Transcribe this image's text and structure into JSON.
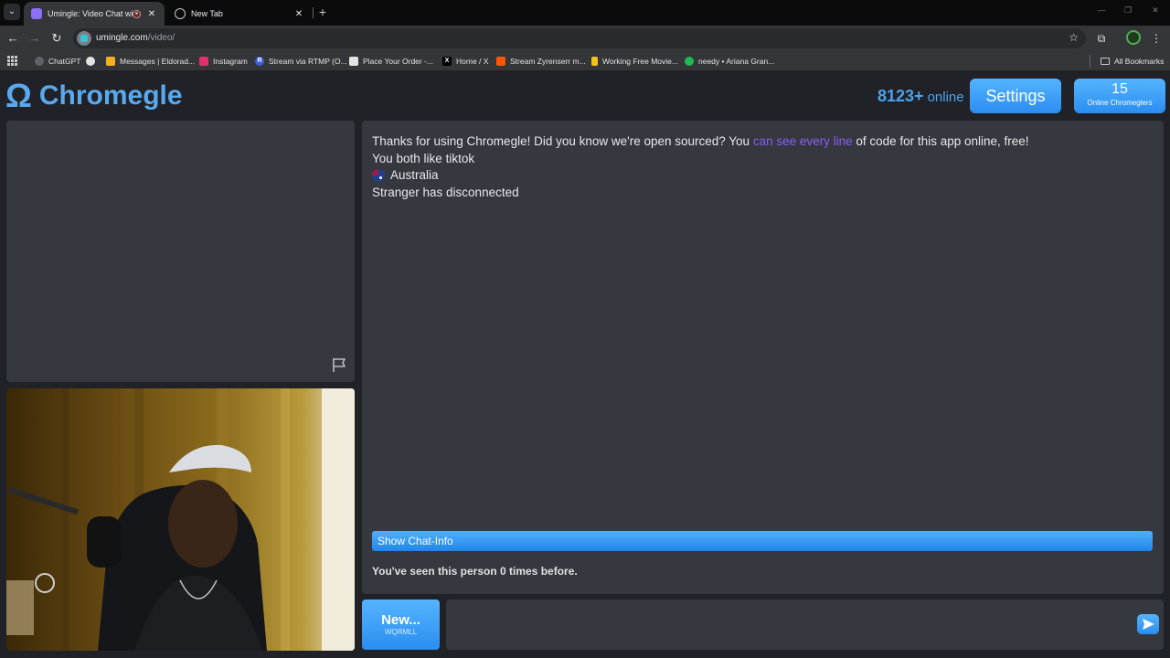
{
  "browser": {
    "tabs": [
      {
        "title": "Umingle: Video Chat with S",
        "active": true
      },
      {
        "title": "New Tab",
        "active": false
      }
    ],
    "url_host": "umingle.com",
    "url_path": "/video/",
    "bookmarks": [
      {
        "label": "ChatGPT",
        "icon": "chatgpt-icon",
        "color": "#5f6368"
      },
      {
        "label": "",
        "icon": "globe-icon",
        "color": "#5f6368"
      },
      {
        "label": "Messages | Eldorad...",
        "icon": "messages-icon",
        "color": "#f2b01e"
      },
      {
        "label": "Instagram",
        "icon": "instagram-icon",
        "color": "#e1306c"
      },
      {
        "label": "Stream via RTMP (O...",
        "icon": "rtmp-icon",
        "color": "#3b5bdb"
      },
      {
        "label": "Place Your Order -...",
        "icon": "order-icon",
        "color": "#8a8a8a"
      },
      {
        "label": "Home / X",
        "icon": "x-icon",
        "color": "#000000"
      },
      {
        "label": "Stream Zyrenserr m...",
        "icon": "stream-icon",
        "color": "#ff5500"
      },
      {
        "label": "Working Free Movie...",
        "icon": "movie-icon",
        "color": "#f0c419"
      },
      {
        "label": "needy • Ariana Gran...",
        "icon": "spotify-icon",
        "color": "#1db954"
      }
    ],
    "all_bookmarks": "All Bookmarks"
  },
  "header": {
    "logo_text": "Chromegle",
    "online_count": "8123",
    "online_plus": "+",
    "online_word": "online",
    "settings_label": "Settings",
    "ext_count": "15",
    "ext_label": "Online Chromeglers"
  },
  "chat": {
    "welcome_before": "Thanks for using Chromegle! Did you know we're open sourced? You ",
    "welcome_link": "can see every line",
    "welcome_after": " of code for this app online, free!",
    "interests": "You both like tiktok",
    "country": "Australia",
    "status": "Stranger has disconnected",
    "show_info": "Show Chat-Info",
    "seen": "You've seen this person 0 times before."
  },
  "controls": {
    "new_label": "New...",
    "new_sub": "WQRMLL",
    "message_value": ""
  },
  "colors": {
    "accent": "#2a8ef0",
    "link": "#8b5cf6",
    "panel": "#36383f",
    "page_bg": "#202227"
  }
}
